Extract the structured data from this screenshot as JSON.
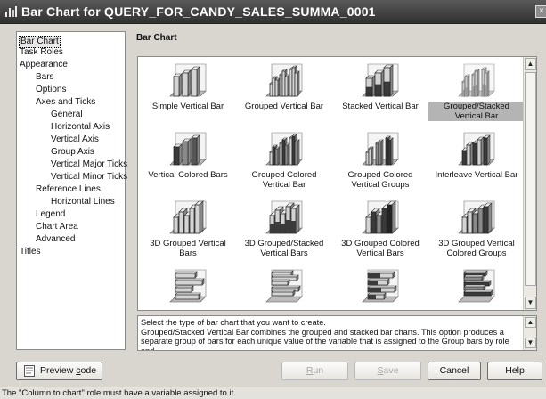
{
  "window": {
    "title": "Bar Chart for QUERY_FOR_CANDY_SALES_SUMMA_0001",
    "close_glyph": "×"
  },
  "nav": {
    "items": [
      {
        "label": "Bar Chart"
      },
      {
        "label": "Task Roles"
      },
      {
        "label": "Appearance"
      },
      {
        "label": "Bars"
      },
      {
        "label": "Options"
      },
      {
        "label": "Axes and Ticks"
      },
      {
        "label": "General"
      },
      {
        "label": "Horizontal Axis"
      },
      {
        "label": "Vertical Axis"
      },
      {
        "label": "Group Axis"
      },
      {
        "label": "Vertical Major Ticks"
      },
      {
        "label": "Vertical Minor Ticks"
      },
      {
        "label": "Reference Lines"
      },
      {
        "label": "Horizontal Lines"
      },
      {
        "label": "Legend"
      },
      {
        "label": "Chart Area"
      },
      {
        "label": "Advanced"
      },
      {
        "label": "Titles"
      }
    ],
    "selected": "Bar Chart"
  },
  "main": {
    "heading": "Bar Chart",
    "chart_types": [
      {
        "label": "Simple Vertical Bar",
        "icon": "simple-vertical-bar-icon"
      },
      {
        "label": "Grouped Vertical Bar",
        "icon": "grouped-vertical-bar-icon"
      },
      {
        "label": "Stacked Vertical Bar",
        "icon": "stacked-vertical-bar-icon"
      },
      {
        "label": "Grouped/Stacked Vertical Bar",
        "icon": "grouped-stacked-vertical-bar-icon",
        "selected": true
      },
      {
        "label": "Vertical Colored Bars",
        "icon": "vertical-colored-bars-icon"
      },
      {
        "label": "Grouped Colored Vertical Bar",
        "icon": "grouped-colored-vertical-bar-icon"
      },
      {
        "label": "Grouped Colored Vertical Groups",
        "icon": "grouped-colored-vertical-groups-icon"
      },
      {
        "label": "Interleave Vertical Bar",
        "icon": "interleave-vertical-bar-icon"
      },
      {
        "label": "3D Grouped Vertical Bars",
        "icon": "3d-grouped-vertical-bars-icon"
      },
      {
        "label": "3D Grouped/Stacked Vertical Bars",
        "icon": "3d-grouped-stacked-vertical-bars-icon"
      },
      {
        "label": "3D Grouped Colored Vertical Bars",
        "icon": "3d-grouped-colored-vertical-bars-icon"
      },
      {
        "label": "3D Grouped Vertical Colored Groups",
        "icon": "3d-grouped-vertical-colored-groups-icon"
      },
      {
        "label": "",
        "icon": "horizontal-bar-icon"
      },
      {
        "label": "",
        "icon": "grouped-horizontal-bar-icon"
      },
      {
        "label": "",
        "icon": "stacked-horizontal-bar-icon"
      },
      {
        "label": "",
        "icon": "grouped-stacked-horizontal-bar-icon"
      }
    ],
    "description": "Select the type of bar chart that you want to create.\nGrouped/Stacked Vertical Bar combines the grouped and stacked bar charts. This option produces a separate group of bars for each unique value of the variable that is assigned to the Group bars by role and"
  },
  "buttons": {
    "preview_prefix": "Preview ",
    "preview_underlined": "c",
    "preview_suffix": "ode",
    "run_underlined": "R",
    "run_suffix": "un",
    "save_underlined": "S",
    "save_suffix": "ave",
    "cancel": "Cancel",
    "help": "Help"
  },
  "status": "The \"Column to chart\" role must have a variable assigned to it.",
  "colors": {
    "selection_gray": "#b4b4b4",
    "bar_dark": "#404040",
    "bar_light": "#d0d0d0"
  }
}
